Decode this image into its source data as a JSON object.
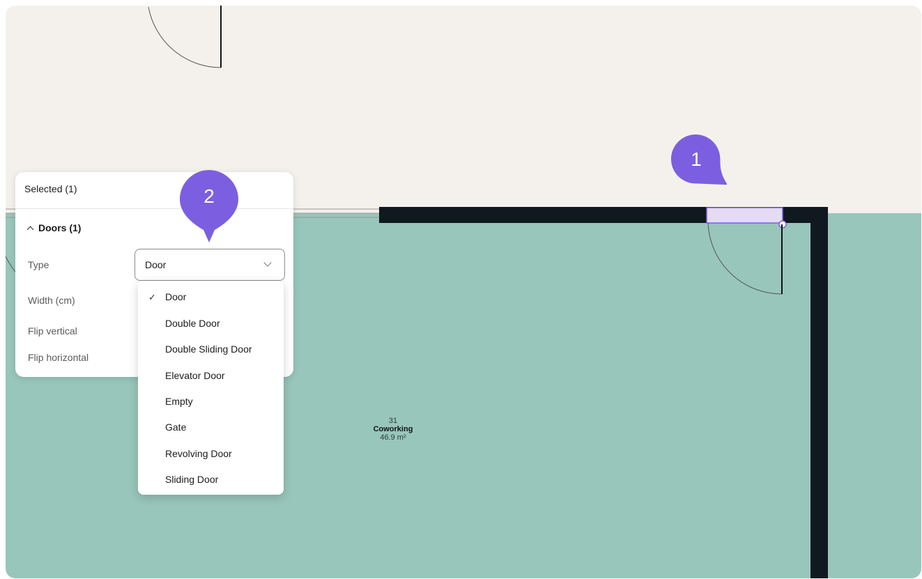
{
  "selected_header": "Selected (1)",
  "section": {
    "label": "Doors (1)"
  },
  "properties": {
    "type_label": "Type",
    "width_label": "Width (cm)",
    "flip_vertical_label": "Flip vertical",
    "flip_horizontal_label": "Flip horizontal"
  },
  "type_select": {
    "value": "Door"
  },
  "dropdown": {
    "selected": "Door",
    "check_glyph": "✓",
    "options": [
      "Door",
      "Double Door",
      "Double Sliding Door",
      "Elevator Door",
      "Empty",
      "Gate",
      "Revolving Door",
      "Sliding Door"
    ]
  },
  "room": {
    "number": "31",
    "name": "Coworking",
    "area": "46.9 m²"
  },
  "callouts": [
    "1",
    "2"
  ],
  "colors": {
    "outside": "#f4f1ec",
    "room_fill": "#98c6bb",
    "wall": "#101820",
    "accent": "#7b5fe0",
    "selection_fill": "#e5dcf3"
  },
  "icons": {
    "section_toggle": "chevron-up-icon",
    "select_arrow": "chevron-down-icon",
    "selected_option": "check-icon"
  }
}
